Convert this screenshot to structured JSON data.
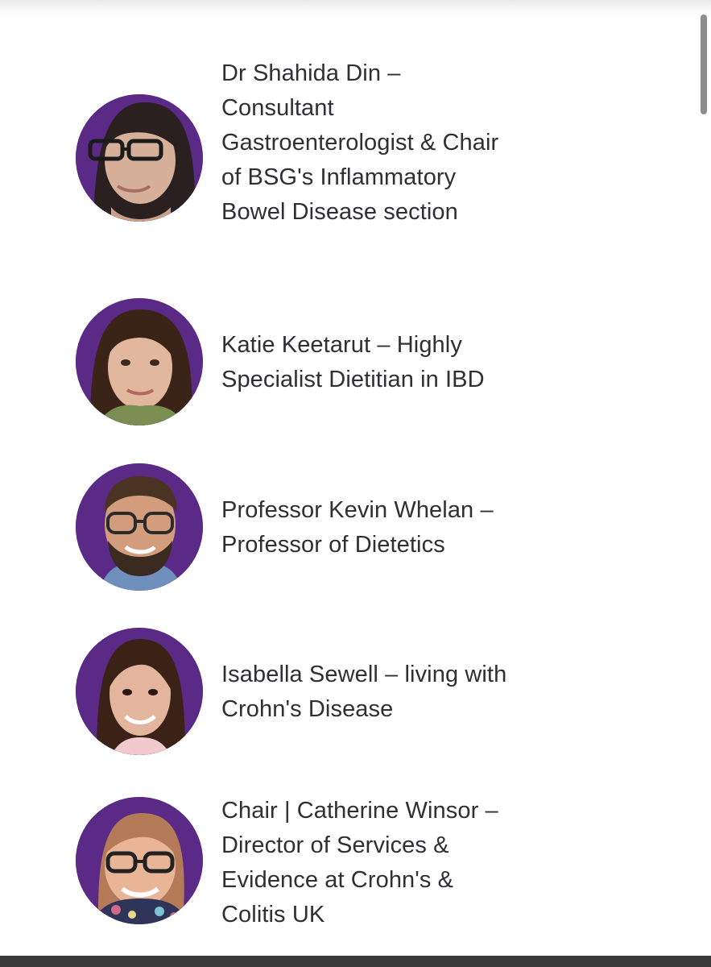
{
  "speakers": [
    {
      "text": "Dr Shahida Din – Consultant Gastroenterologist & Chair of BSG's Inflammatory Bowel Disease section",
      "avatar_icon": "portrait-photo-woman-glasses"
    },
    {
      "text": "Katie Keetarut – Highly Specialist Dietitian in IBD",
      "avatar_icon": "portrait-photo-woman"
    },
    {
      "text": "Professor Kevin Whelan – Professor of Dietetics",
      "avatar_icon": "portrait-photo-man-beard-glasses"
    },
    {
      "text": "Isabella Sewell – living with Crohn's Disease",
      "avatar_icon": "portrait-photo-woman"
    },
    {
      "text": "Chair | Catherine Winsor – Director of Services & Evidence at Crohn's & Colitis UK",
      "avatar_icon": "portrait-photo-woman-glasses"
    }
  ],
  "colors": {
    "avatar_background": "#5b2a86",
    "text": "#2f2f34",
    "footer": "#3a3a3a"
  }
}
